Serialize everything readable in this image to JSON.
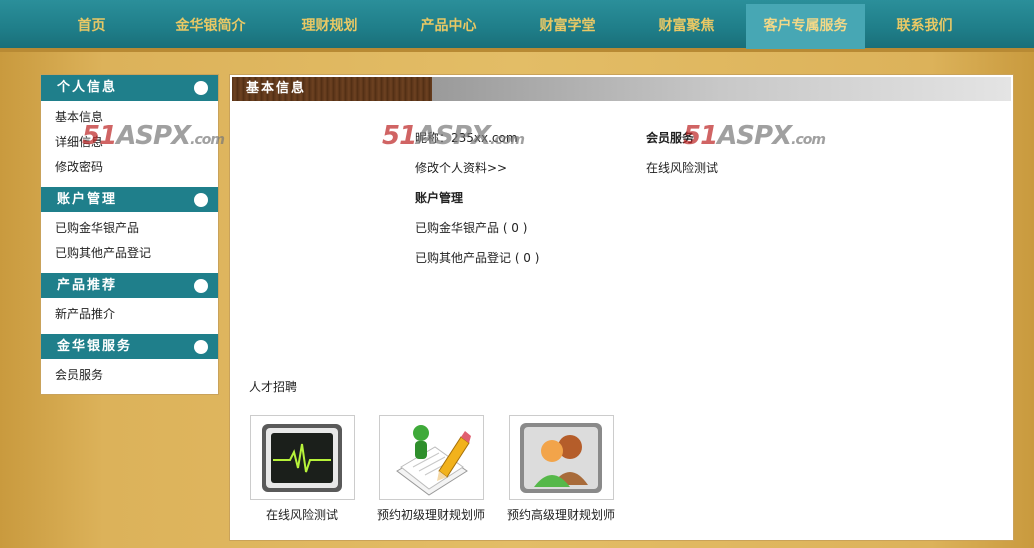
{
  "nav": {
    "items": [
      {
        "label": "首页"
      },
      {
        "label": "金华银简介"
      },
      {
        "label": "理财规划"
      },
      {
        "label": "产品中心"
      },
      {
        "label": "财富学堂"
      },
      {
        "label": "财富聚焦"
      },
      {
        "label": "客户专属服务",
        "active": true
      },
      {
        "label": "联系我们"
      }
    ]
  },
  "sidebar": {
    "groups": [
      {
        "title": "个人信息",
        "items": [
          "基本信息",
          "详细信息",
          "修改密码"
        ]
      },
      {
        "title": "账户管理",
        "items": [
          "已购金华银产品",
          "已购其他产品登记"
        ]
      },
      {
        "title": "产品推荐",
        "items": [
          "新产品推介"
        ]
      },
      {
        "title": "金华银服务",
        "items": [
          "会员服务"
        ]
      }
    ]
  },
  "main": {
    "title": "基本信息",
    "col1": {
      "nickname_line": "昵称：235xx.com",
      "edit_link": "修改个人资料>>",
      "account_heading": "账户管理",
      "bought_jhy": "已购金华银产品 ( 0 )",
      "bought_other": "已购其他产品登记 ( 0 )"
    },
    "col2": {
      "member_heading": "会员服务",
      "risk_test": "在线风险测试"
    },
    "recruit": "人才招聘",
    "tiles": [
      {
        "caption": "在线风险测试",
        "icon": "heartbeat-monitor-icon"
      },
      {
        "caption": "预约初级理财规划师",
        "icon": "pencil-document-icon"
      },
      {
        "caption": "预约高级理财规划师",
        "icon": "users-icon"
      }
    ]
  },
  "watermark": {
    "num": "51",
    "brand": "ASPX",
    "suffix": ".com"
  },
  "colors": {
    "nav_bg": "#1f7e89",
    "nav_active": "#47a7b4",
    "nav_text": "#e8c865",
    "side_head": "#1f7f8b",
    "page_bg": "#e3bd66"
  }
}
